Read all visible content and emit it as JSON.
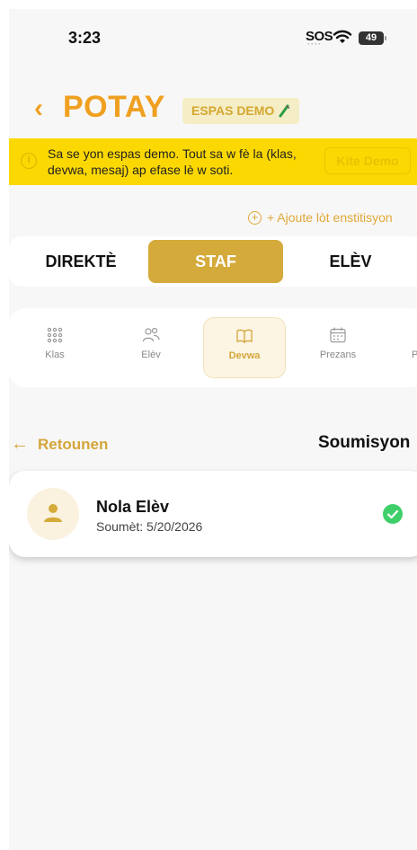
{
  "status_bar": {
    "time": "3:23",
    "sos": "SOS",
    "battery": "49"
  },
  "header": {
    "back_icon": "chevron-left-icon",
    "title": "POTAY",
    "badge": "ESPAS DEMO",
    "badge_icon": "test-tube-icon"
  },
  "banner": {
    "icon": "info-icon",
    "message": "Sa se yon espas demo. Tout sa w fè la (klas, devwa, mesaj) ap efase lè w soti.",
    "button": "Kite Demo"
  },
  "add_institution": "+ Ajoute lòt enstitisyon",
  "roles": [
    {
      "label": "DIREKTÈ",
      "active": false
    },
    {
      "label": "STAF",
      "active": true
    },
    {
      "label": "ELÈV",
      "active": false
    }
  ],
  "tabs": [
    {
      "label": "Klas",
      "icon": "grid-icon",
      "active": false
    },
    {
      "label": "Elèv",
      "icon": "users-icon",
      "active": false
    },
    {
      "label": "Devwa",
      "icon": "book-icon",
      "active": true
    },
    {
      "label": "Prezans",
      "icon": "calendar-icon",
      "active": false
    },
    {
      "label": "P",
      "icon": "",
      "active": false
    }
  ],
  "section": {
    "back_label": "Retounen",
    "title": "Soumisyon"
  },
  "submissions": [
    {
      "name": "Nola Elèv",
      "submitted": "Soumèt: 5/20/2026",
      "status_icon": "check-circle-icon"
    }
  ],
  "colors": {
    "accent": "#f0a020",
    "gold": "#d4aa3a",
    "banner": "#fcd802",
    "success": "#3fcf6a"
  }
}
